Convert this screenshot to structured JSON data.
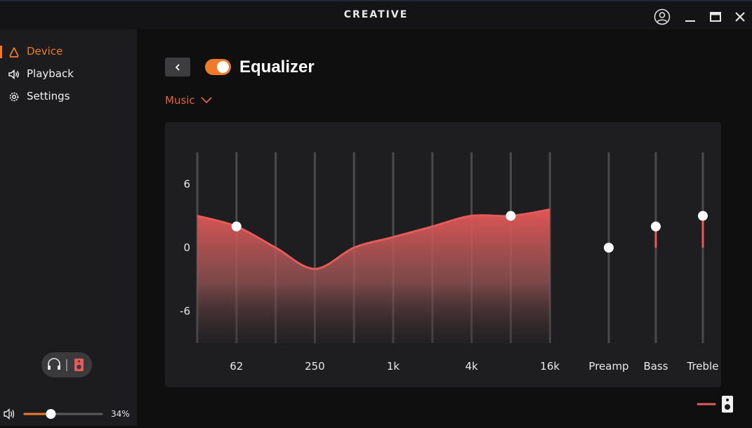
{
  "app": {
    "brand": "CREATIVE",
    "accent": "#f07a2b"
  },
  "sidebar": {
    "items": [
      {
        "label": "Device",
        "icon": "device-icon",
        "active": true
      },
      {
        "label": "Playback",
        "icon": "speaker-icon",
        "active": false
      },
      {
        "label": "Settings",
        "icon": "gear-icon",
        "active": false
      }
    ],
    "output_toggle": {
      "left_icon": "headphones-icon",
      "right_icon": "speaker-box-icon",
      "selected": "speaker"
    },
    "volume": {
      "value": 34,
      "label": "34%"
    }
  },
  "header": {
    "title": "Equalizer",
    "enabled": true,
    "preset": "Music"
  },
  "eq": {
    "y_ticks": [
      "6",
      "0",
      "-6"
    ],
    "y_range": [
      -9,
      9
    ],
    "freq_labels": [
      "62",
      "250",
      "1k",
      "4k",
      "16k"
    ],
    "bands": [
      {
        "value": 3.0,
        "handle": false
      },
      {
        "value": 2.0,
        "handle": true
      },
      {
        "value": 0.0,
        "handle": false
      },
      {
        "value": -2.0,
        "handle": false
      },
      {
        "value": 0.0,
        "handle": false
      },
      {
        "value": 1.0,
        "handle": false
      },
      {
        "value": 2.0,
        "handle": false
      },
      {
        "value": 3.0,
        "handle": false
      },
      {
        "value": 3.0,
        "handle": true
      },
      {
        "value": 3.6,
        "handle": false
      }
    ],
    "extra": [
      {
        "label": "Preamp",
        "value": 0
      },
      {
        "label": "Bass",
        "value": 2
      },
      {
        "label": "Treble",
        "value": 3
      }
    ],
    "curve_color": "#e55a5a",
    "handle_color": "#ffffff"
  }
}
